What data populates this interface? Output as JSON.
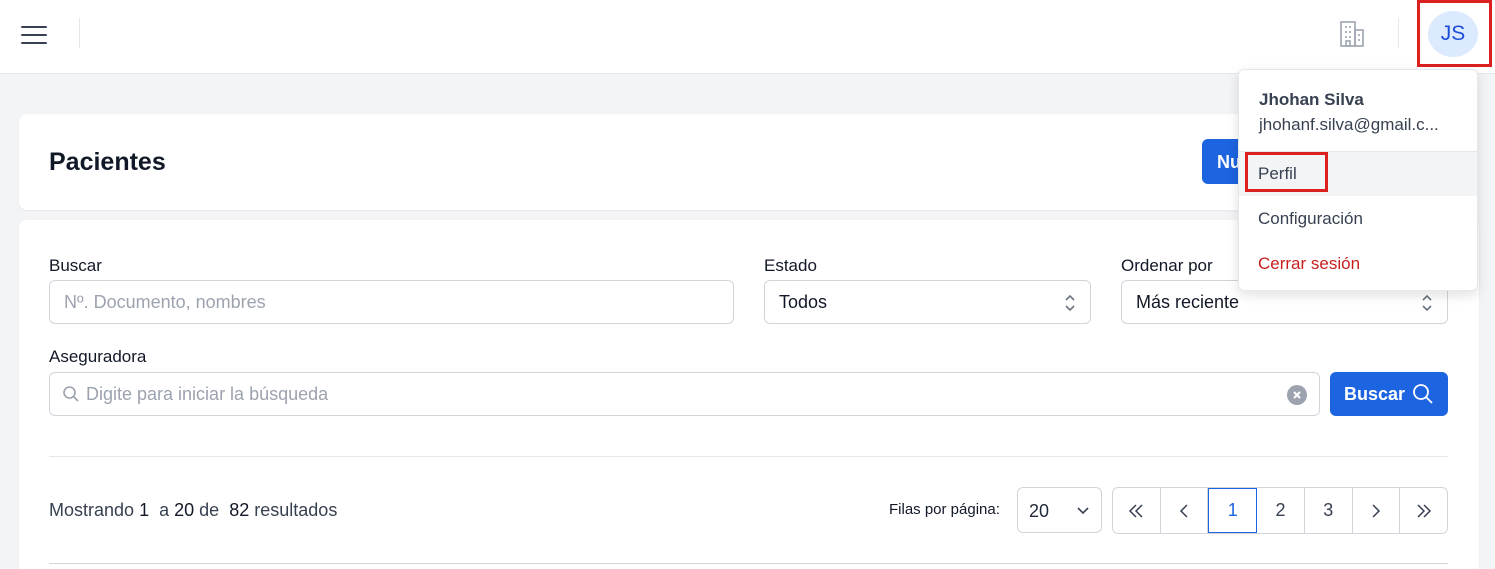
{
  "topbar": {
    "menu_icon": "hamburger-menu-icon",
    "building_icon": "building-icon",
    "avatar_initials": "JS"
  },
  "header": {
    "title": "Pacientes",
    "new_button_label": "Nu"
  },
  "filters": {
    "buscar_label": "Buscar",
    "buscar_placeholder": "Nº. Documento, nombres",
    "estado_label": "Estado",
    "estado_value": "Todos",
    "ordenar_label": "Ordenar por",
    "ordenar_value": "Más reciente",
    "aseguradora_label": "Aseguradora",
    "aseguradora_placeholder": "Digite para iniciar la búsqueda",
    "search_button_label": "Buscar"
  },
  "results": {
    "prefix": "Mostrando",
    "from": "1",
    "to_word": "a",
    "to": "20",
    "of_word": "de",
    "total": "82",
    "suffix": "resultados"
  },
  "pagination": {
    "rows_label": "Filas por página:",
    "rows_value": "20",
    "pages": [
      "1",
      "2",
      "3"
    ],
    "current_page": "1"
  },
  "user_menu": {
    "name": "Jhohan Silva",
    "email": "jhohanf.silva@gmail.c...",
    "items": [
      {
        "label": "Perfil",
        "color": "#374151"
      },
      {
        "label": "Configuración",
        "color": "#374151"
      },
      {
        "label": "Cerrar sesión",
        "color": "#c81e1e"
      }
    ]
  },
  "colors": {
    "primary": "#1d64e0",
    "highlight": "#dc1f1f",
    "danger": "#c81e1e"
  }
}
